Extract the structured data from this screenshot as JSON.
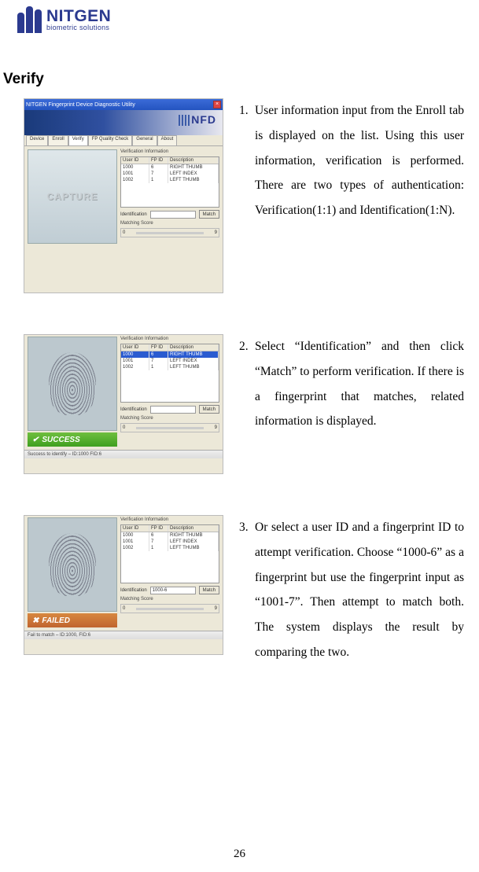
{
  "logo": {
    "title": "NITGEN",
    "subtitle": "biometric solutions"
  },
  "section_title": "Verify",
  "page_number": "26",
  "window": {
    "title": "NITGEN Fingerprint Device Diagnostic Utility",
    "banner_brand": "NFD",
    "tabs": [
      "Device",
      "Enroll",
      "Verify",
      "FP Quality Check",
      "General",
      "About"
    ],
    "capture_label": "CAPTURE",
    "verification_info_label": "Verification Information",
    "identification_label": "Identification",
    "match_button": "Match",
    "matching_score_label": "Matching Score",
    "grid_headers": {
      "c1": "User ID",
      "c2": "FP ID",
      "c3": "Description"
    },
    "rows_all": [
      {
        "c1": "1000",
        "c2": "6",
        "c3": "RIGHT THUMB"
      },
      {
        "c1": "1001",
        "c2": "7",
        "c3": "LEFT INDEX"
      },
      {
        "c1": "1002",
        "c2": "1",
        "c3": "LEFT THUMB"
      }
    ],
    "id_field_value": "1000-6",
    "score_min": "0",
    "score_max": "9",
    "success_text": "SUCCESS",
    "failed_text": "FAILED",
    "status_success": "Success to identify – ID:1000 FID:6",
    "status_failed": "Fail to match – ID:1000, FID:6"
  },
  "steps": [
    {
      "num": "1.",
      "text": "User information input from the Enroll tab is displayed on the list. Using this user information, verification is performed. There are two types of authentication: Verification(1:1) and Identification(1:N)."
    },
    {
      "num": "2.",
      "text": "Select “Identification” and then click “Match” to perform verification. If there is a fingerprint that matches, related information is displayed."
    },
    {
      "num": "3.",
      "text": "Or select a user ID and a fingerprint ID to attempt verification. Choose “1000-6” as a fingerprint but use the fingerprint input as “1001-7”. Then attempt to match both. The system displays the result by comparing the two."
    }
  ]
}
